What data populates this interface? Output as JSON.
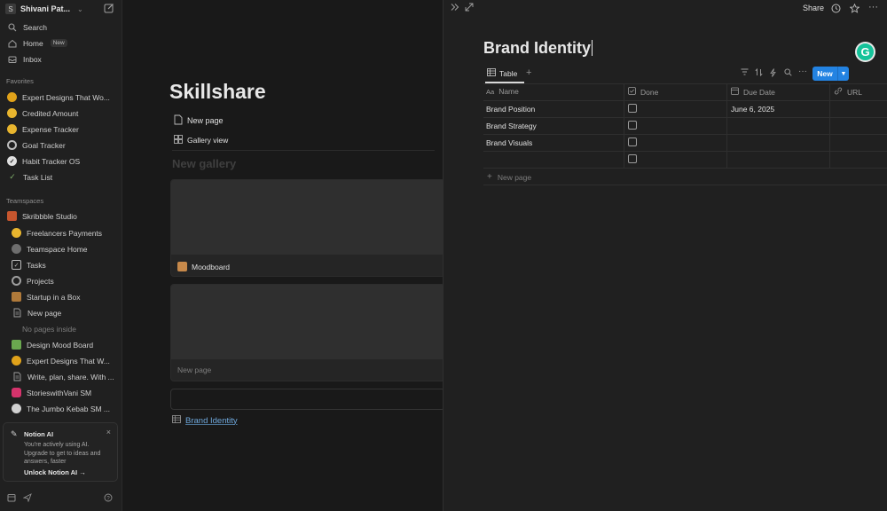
{
  "sidebar": {
    "workspace": {
      "avatar": "S",
      "name": "Shivani Pat...",
      "chevron": "⌄"
    },
    "nav": [
      {
        "label": "Search",
        "icon": "search-icon"
      },
      {
        "label": "Home",
        "icon": "home-icon",
        "badge": "New"
      },
      {
        "label": "Inbox",
        "icon": "inbox-icon"
      }
    ],
    "favorites_heading": "Favorites",
    "favorites": [
      {
        "label": "Expert Designs That Wo...",
        "icon": "sunflower-icon"
      },
      {
        "label": "Credited Amount",
        "icon": "smiley-icon"
      },
      {
        "label": "Expense Tracker",
        "icon": "smiley-icon"
      },
      {
        "label": "Goal Tracker",
        "icon": "target-icon"
      },
      {
        "label": "Habit Tracker OS",
        "icon": "check-circle-icon"
      },
      {
        "label": "Task List",
        "icon": "checkmark-icon"
      }
    ],
    "teamspaces_heading": "Teamspaces",
    "teamspace": {
      "label": "Skribbble Studio",
      "icon": "house-icon"
    },
    "team_items": [
      {
        "label": "Freelancers Payments",
        "icon": "money-face-icon"
      },
      {
        "label": "Teamspace Home",
        "icon": "compass-icon"
      },
      {
        "label": "Tasks",
        "icon": "checkbox-icon"
      },
      {
        "label": "Projects",
        "icon": "target-icon"
      },
      {
        "label": "Startup in a Box",
        "icon": "box-icon"
      },
      {
        "label": "New page",
        "icon": "page-icon"
      }
    ],
    "no_pages": "No pages inside",
    "more_items": [
      {
        "label": "Design Mood Board",
        "icon": "picture-icon"
      },
      {
        "label": "Expert Designs That W...",
        "icon": "sunflower-icon"
      },
      {
        "label": "Write, plan, share. With ...",
        "icon": "page-icon"
      },
      {
        "label": "StorieswithVani SM",
        "icon": "instagram-icon"
      },
      {
        "label": "The Jumbo Kebab SM ...",
        "icon": "plate-icon"
      }
    ],
    "ai_card": {
      "title": "Notion AI",
      "body": "You're actively using AI. Upgrade to get to ideas and answers, faster",
      "link": "Unlock Notion AI"
    }
  },
  "main": {
    "title": "Skillshare",
    "new_page": "New page",
    "gallery_view": "Gallery view",
    "gallery_title": "New gallery",
    "cards": [
      {
        "label": "Moodboard"
      },
      {
        "label": "New page"
      }
    ],
    "brand_link": "Brand Identity"
  },
  "peek": {
    "share": "Share",
    "db_title": "Brand Identity",
    "grammarly": "G",
    "view_tab": "Table",
    "new_button": "New",
    "columns": {
      "name": "Name",
      "done": "Done",
      "due": "Due Date",
      "url": "URL"
    },
    "rows": [
      {
        "name": "Brand Position",
        "due": "June 6, 2025"
      },
      {
        "name": "Brand Strategy",
        "due": ""
      },
      {
        "name": "Brand Visuals",
        "due": ""
      },
      {
        "name": "",
        "due": ""
      }
    ],
    "add_row": "New page"
  },
  "colors": {
    "accent": "#2383e2",
    "link": "#6fa8dc",
    "background": "#191919",
    "sidebar": "#202020"
  }
}
